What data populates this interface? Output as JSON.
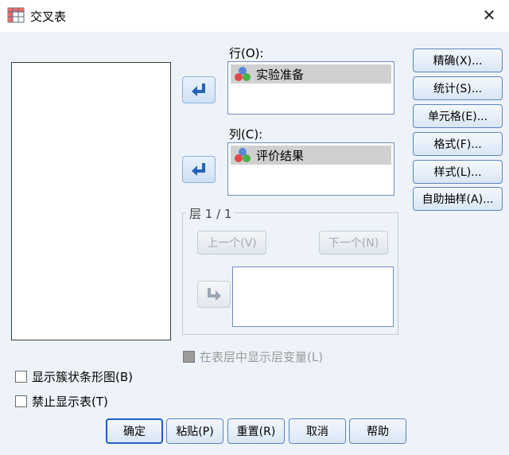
{
  "window": {
    "title": "交叉表"
  },
  "row_field": {
    "label": "行(O):",
    "variable": "实验准备"
  },
  "col_field": {
    "label": "列(C):",
    "variable": "评价结果"
  },
  "side_buttons": [
    "精确(X)...",
    "统计(S)...",
    "单元格(E)...",
    "格式(F)...",
    "样式(L)...",
    "自助抽样(A)..."
  ],
  "layer": {
    "title": "层 1 / 1",
    "prev_label": "上一个(V)",
    "next_label": "下一个(N)"
  },
  "checkboxes": {
    "show_layer_vars": {
      "label": "在表层中显示层变量(L)",
      "checked": false,
      "enabled": false
    },
    "clustered_bar": {
      "label": "显示簇状条形图(B)",
      "checked": false
    },
    "suppress_tables": {
      "label": "禁止显示表(T)",
      "checked": false
    }
  },
  "bottom_buttons": {
    "ok": "确定",
    "paste": "粘贴(P)",
    "reset": "重置(R)",
    "cancel": "取消",
    "help": "帮助"
  },
  "colors": {
    "arrow": "#2462b7",
    "accent": "#1f5fbf"
  }
}
